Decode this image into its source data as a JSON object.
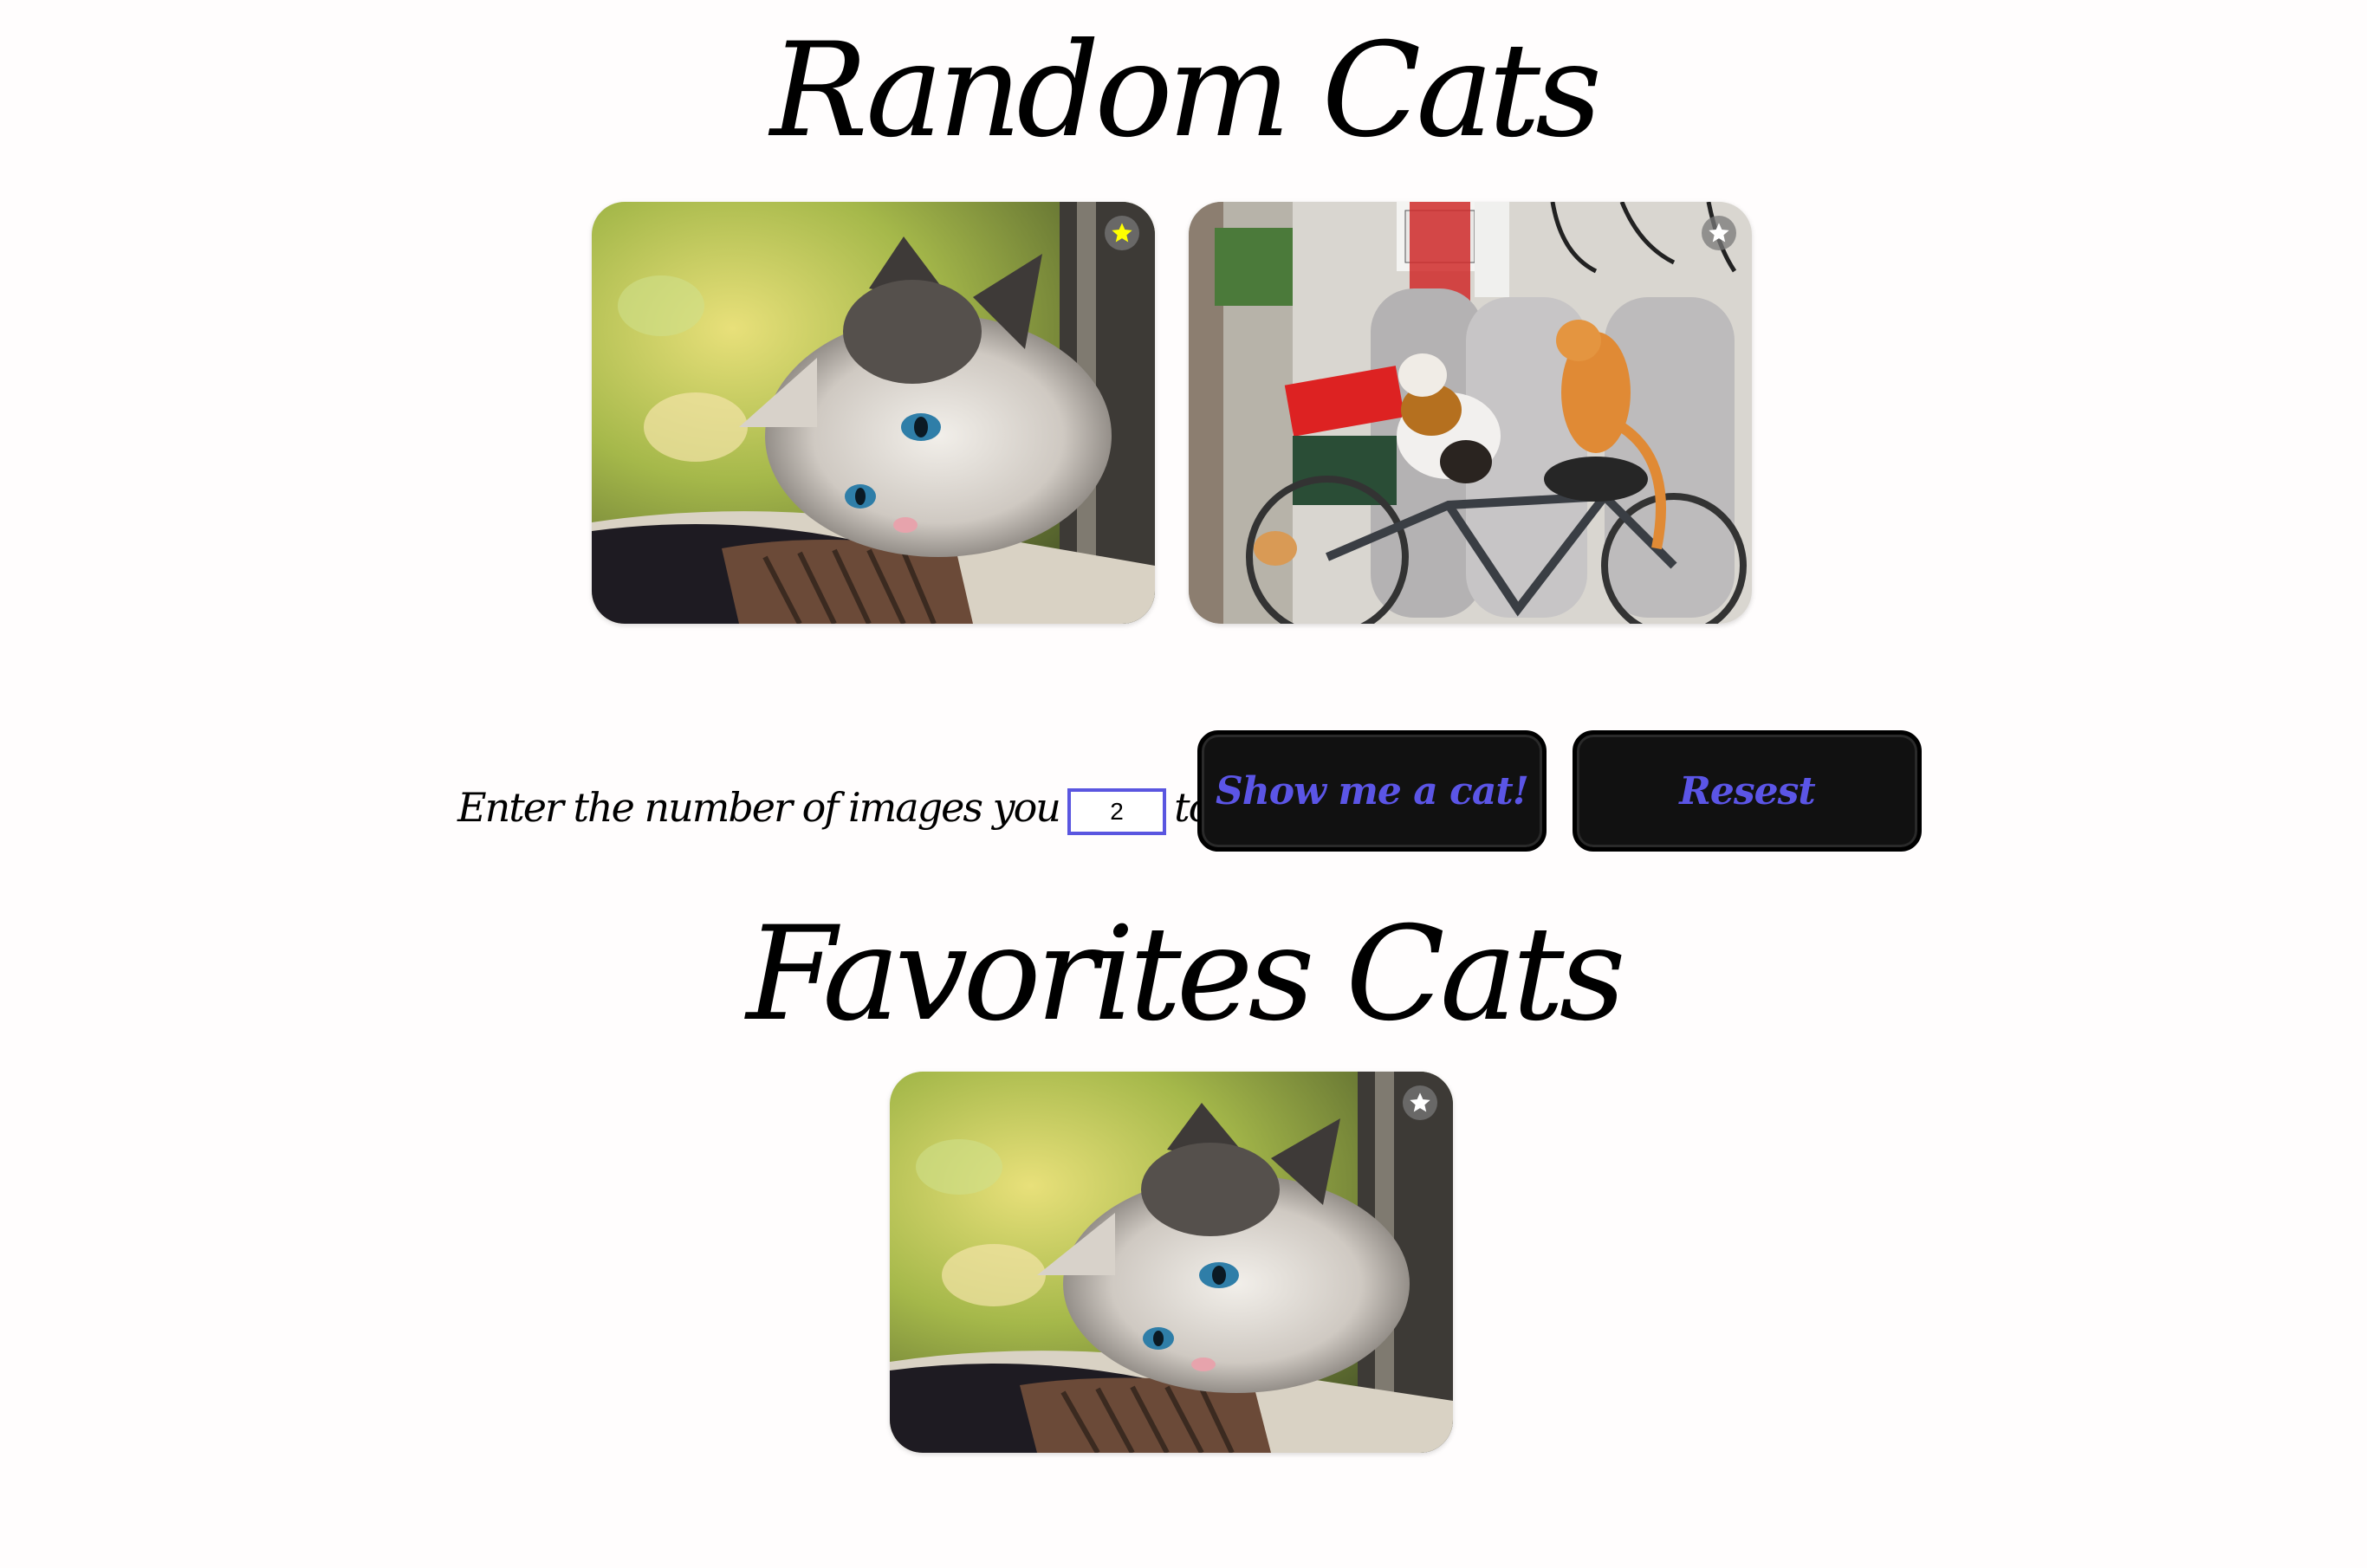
{
  "random_section": {
    "title": "Random Cats",
    "cards": [
      {
        "alt": "kitten resting on blanket",
        "favorited": true,
        "star_color": "#ffff00"
      },
      {
        "alt": "cats on a bicycle near gas tanks",
        "favorited": false,
        "star_color": "#ffffff"
      }
    ]
  },
  "controls": {
    "label": "Enter the number of images you want to see",
    "count_value": "2",
    "show_button": "Show me a cat!",
    "reset_button": "Resest"
  },
  "favorites_section": {
    "title": "Favorites Cats",
    "cards": [
      {
        "alt": "kitten resting on blanket",
        "star_color": "#ffffff"
      }
    ]
  },
  "colors": {
    "accent": "#5b55e6",
    "button_bg": "#111111",
    "favorite_star": "#ffff00"
  }
}
